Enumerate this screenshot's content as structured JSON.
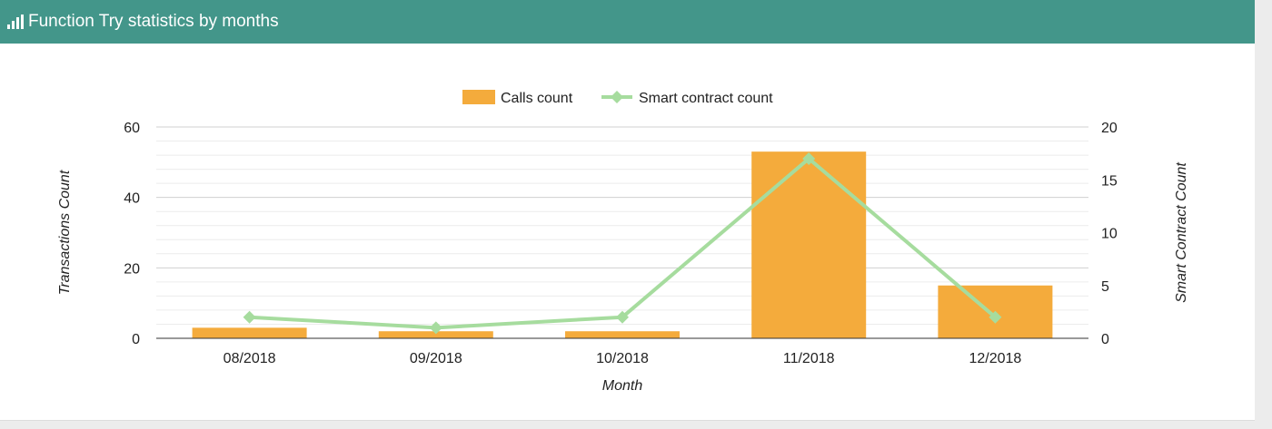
{
  "header": {
    "icon": "bar-chart-icon",
    "title": "Function Try statistics by months"
  },
  "colors": {
    "header_bg": "#43968a",
    "bar": "#f4ab3c",
    "line": "#a6dc9e",
    "grid": "#dddddd"
  },
  "chart_data": {
    "type": "bar",
    "categories": [
      "08/2018",
      "09/2018",
      "10/2018",
      "11/2018",
      "12/2018"
    ],
    "series": [
      {
        "name": "Calls count",
        "type": "bar",
        "axis": "left",
        "values": [
          3,
          2,
          2,
          53,
          15
        ]
      },
      {
        "name": "Smart contract count",
        "type": "line",
        "axis": "right",
        "values": [
          2,
          1,
          2,
          17,
          2
        ]
      }
    ],
    "xlabel": "Month",
    "ylabel": "Transactions Count",
    "y2label": "Smart Contract Count",
    "ylim": [
      0,
      60
    ],
    "y2lim": [
      0,
      20
    ],
    "yticks": [
      0,
      20,
      40,
      60
    ],
    "y2ticks": [
      0,
      5,
      10,
      15,
      20
    ],
    "legend_position": "top-center",
    "grid": true
  }
}
